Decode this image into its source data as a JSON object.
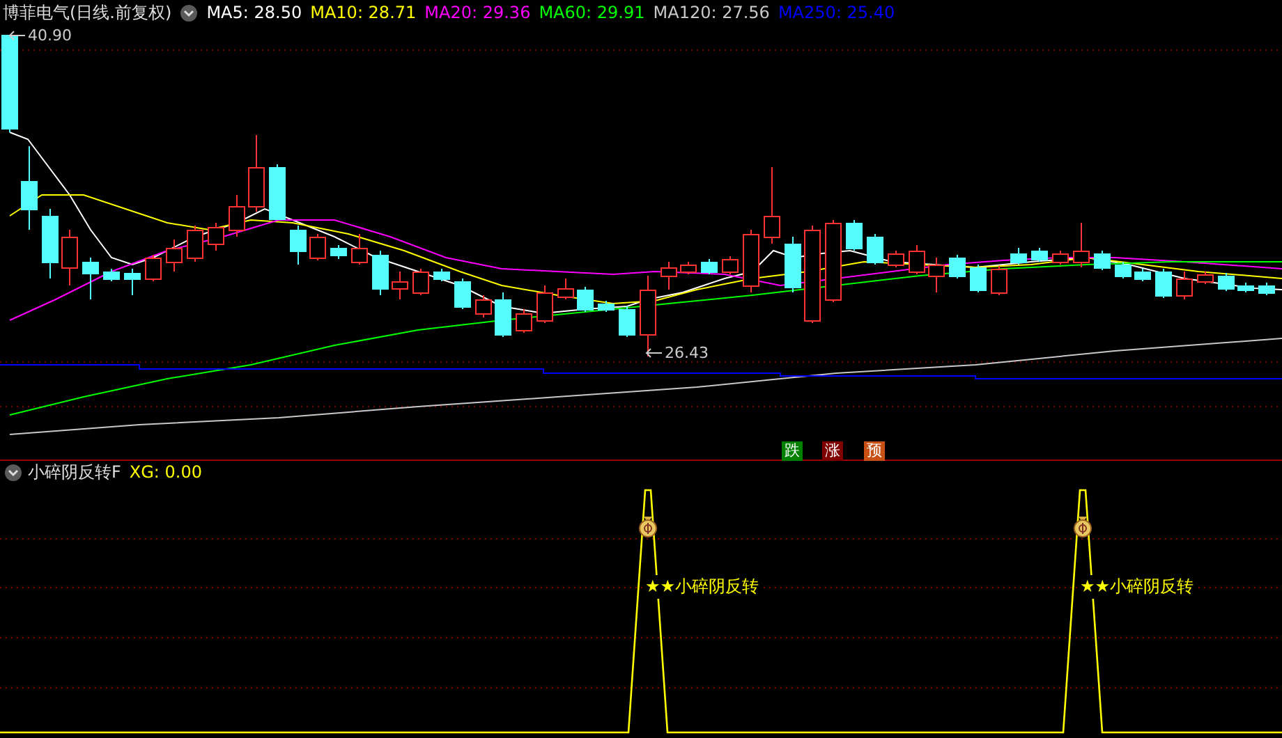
{
  "header": {
    "title": "博菲电气(日线.前复权)",
    "ma": [
      {
        "label": "MA5: 28.50",
        "color": "#ffffff"
      },
      {
        "label": "MA10: 28.71",
        "color": "#ffff00"
      },
      {
        "label": "MA20: 29.36",
        "color": "#ff00ff"
      },
      {
        "label": "MA60: 29.91",
        "color": "#00ff00"
      },
      {
        "label": "MA120: 27.56",
        "color": "#c8c8c8"
      },
      {
        "label": "MA250: 25.40",
        "color": "#0000ff"
      }
    ]
  },
  "main_chart": {
    "high_label": "40.90",
    "low_label": "26.43"
  },
  "markers": [
    {
      "text": "跌",
      "color": "#008000"
    },
    {
      "text": "涨",
      "color": "#800000"
    },
    {
      "text": "预",
      "color": "#c85014"
    }
  ],
  "indicator": {
    "title": "小碎阴反转F",
    "value": "XG: 0.00",
    "signals": [
      {
        "label": "★★小碎阴反转"
      },
      {
        "label": "★★小碎阴反转"
      }
    ]
  }
}
